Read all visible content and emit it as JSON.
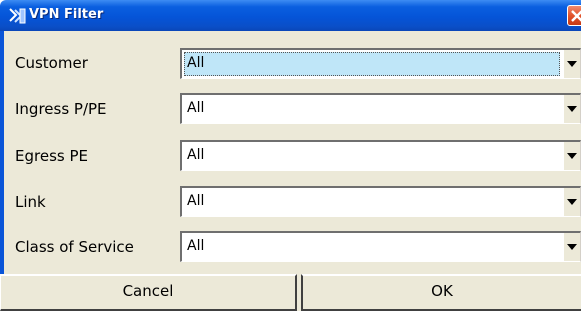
{
  "window": {
    "title": "VPN Filter",
    "icon": "vpn-filter-app-icon",
    "close_icon": "close-icon"
  },
  "filters": [
    {
      "label": "Customer",
      "value": "All"
    },
    {
      "label": "Ingress P/PE",
      "value": "All"
    },
    {
      "label": "Egress PE",
      "value": "All"
    },
    {
      "label": "Link",
      "value": "All"
    },
    {
      "label": "Class of Service",
      "value": "All"
    }
  ],
  "buttons": {
    "cancel": "Cancel",
    "ok": "OK"
  },
  "colors": {
    "titlebar": "#0554d8",
    "close_button": "#e2542c",
    "dialog_background": "#ece9d8",
    "active_field_highlight": "#bfe6f8"
  }
}
